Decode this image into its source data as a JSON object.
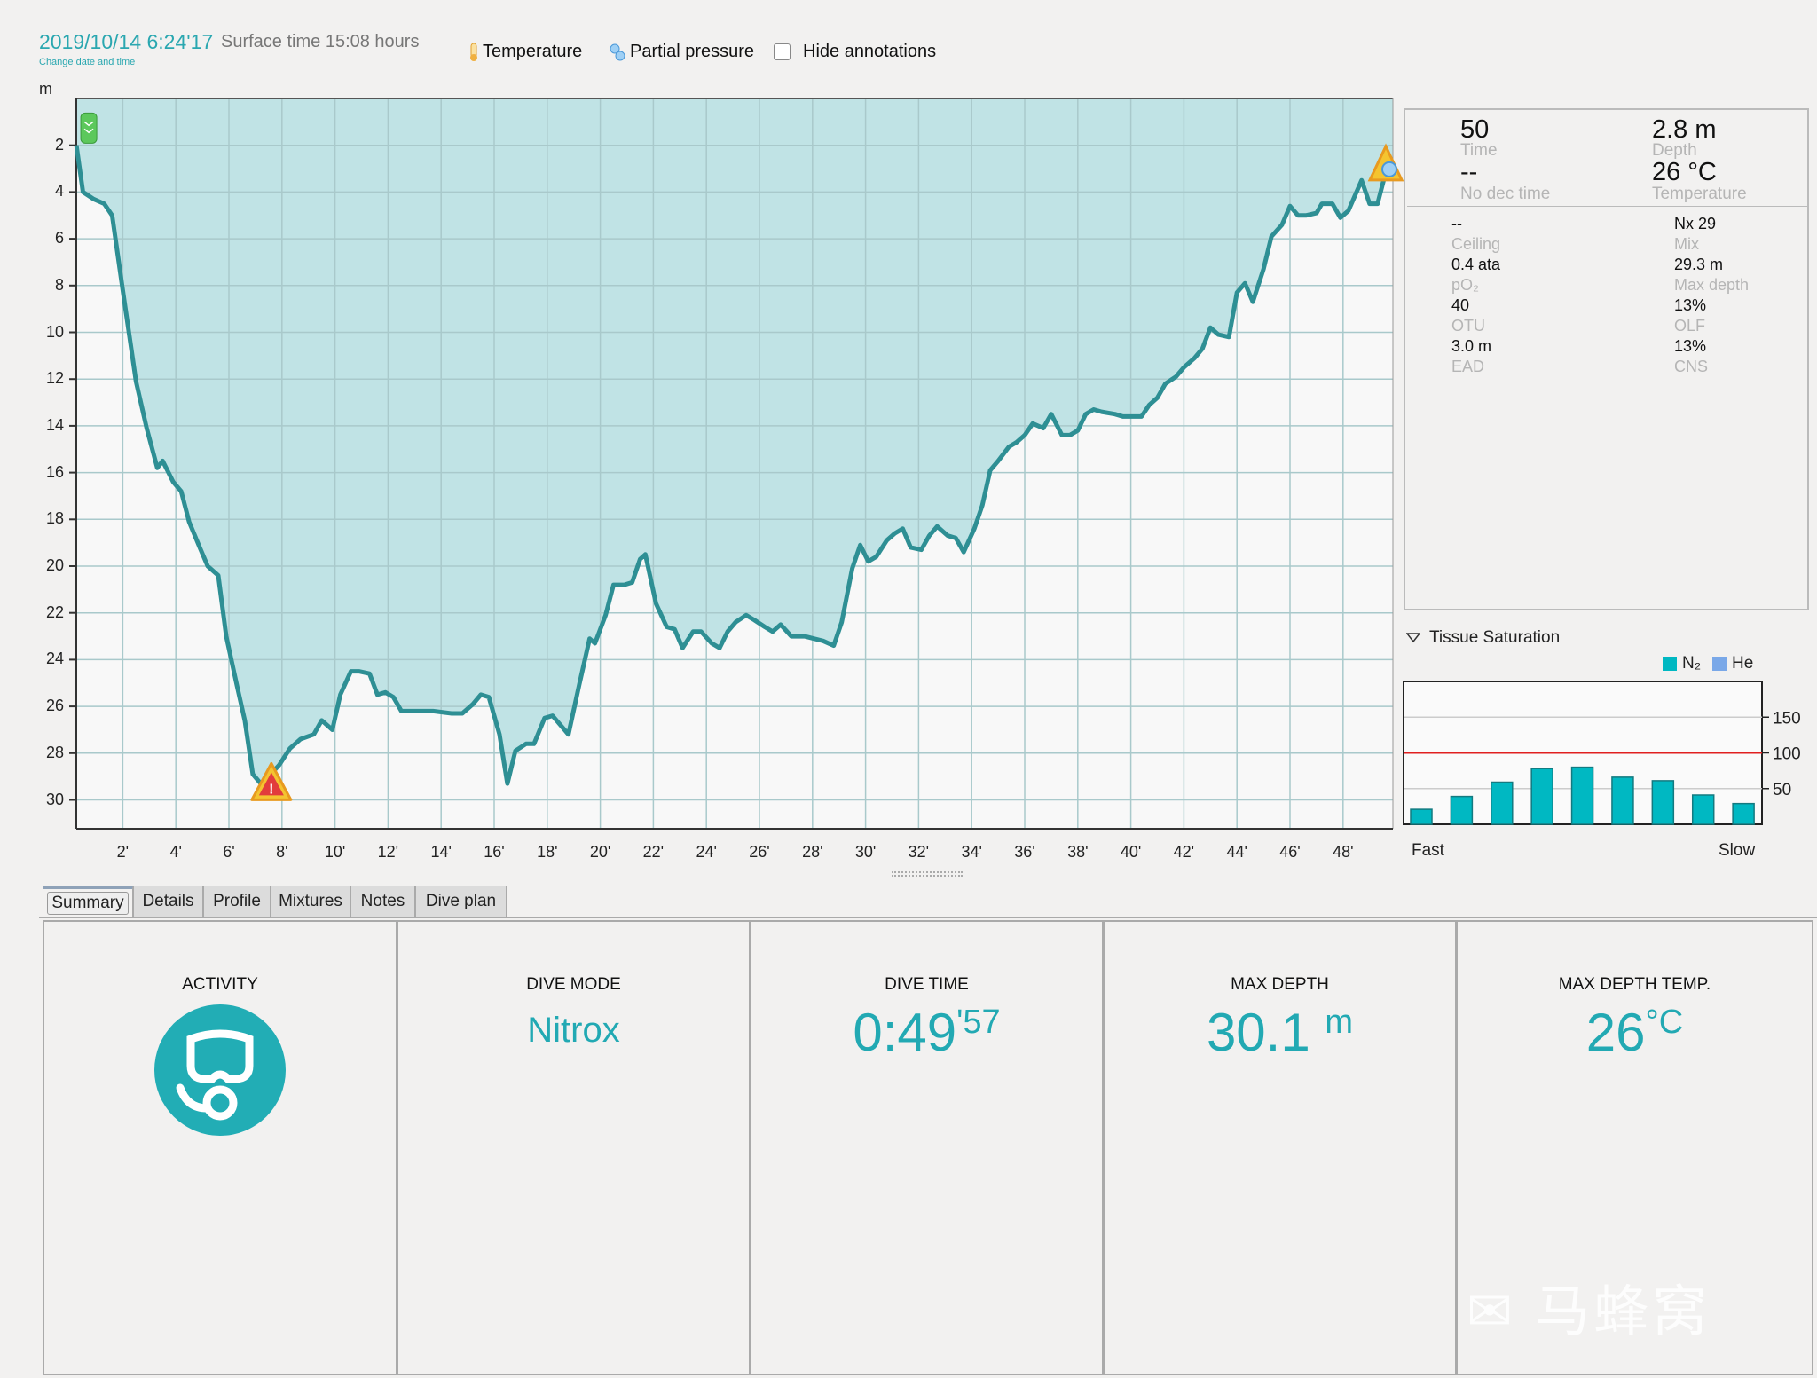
{
  "header": {
    "datetime": "2019/10/14 6:24'17",
    "surface_time": "Surface time 15:08 hours",
    "change_link": "Change date and time",
    "toggles": [
      {
        "label": "Temperature",
        "icon": "thermometer-icon"
      },
      {
        "label": "Partial pressure",
        "icon": "bubbles-icon"
      },
      {
        "label": "Hide annotations",
        "icon": "checkbox",
        "checked": false
      }
    ]
  },
  "colors": {
    "accent": "#22a9b3",
    "profile_fill": "#c0e3e5",
    "profile_line": "#2e8f94",
    "ceiling_line": "#e02020",
    "n2": "#00b8c2",
    "he": "#7aa8e8"
  },
  "chart_data": [
    {
      "type": "area",
      "ylabel": "m",
      "yreversed": true,
      "xlim": [
        0,
        50
      ],
      "ylim": [
        0,
        31.2
      ],
      "grid": true,
      "yticks": [
        2,
        4,
        6,
        8,
        10,
        12,
        14,
        16,
        18,
        20,
        22,
        24,
        26,
        28,
        30
      ],
      "xticks": [
        "2'",
        "4'",
        "6'",
        "8'",
        "10'",
        "12'",
        "14'",
        "16'",
        "18'",
        "20'",
        "22'",
        "24'",
        "26'",
        "28'",
        "30'",
        "32'",
        "34'",
        "36'",
        "38'",
        "40'",
        "42'",
        "44'",
        "46'",
        "48'"
      ],
      "xtick_values": [
        2,
        4,
        6,
        8,
        10,
        12,
        14,
        16,
        18,
        20,
        22,
        24,
        26,
        28,
        30,
        32,
        34,
        36,
        38,
        40,
        42,
        44,
        46,
        48
      ],
      "annotations": [
        {
          "type": "descent",
          "t": 0.25,
          "depth": 1
        },
        {
          "type": "warning",
          "t": 7.5,
          "depth": 29.5
        },
        {
          "type": "end",
          "t": 49.8,
          "depth": 2.5
        }
      ],
      "points": [
        [
          0.25,
          2
        ],
        [
          0.5,
          4
        ],
        [
          0.9,
          4.3
        ],
        [
          1.3,
          4.5
        ],
        [
          1.6,
          5.0
        ],
        [
          2.0,
          8.2
        ],
        [
          2.5,
          12.1
        ],
        [
          2.9,
          14.1
        ],
        [
          3.3,
          15.8
        ],
        [
          3.5,
          15.5
        ],
        [
          3.9,
          16.4
        ],
        [
          4.2,
          16.8
        ],
        [
          4.5,
          18.1
        ],
        [
          4.9,
          19.2
        ],
        [
          5.2,
          20.0
        ],
        [
          5.6,
          20.4
        ],
        [
          5.9,
          23.0
        ],
        [
          6.3,
          25.1
        ],
        [
          6.6,
          26.6
        ],
        [
          6.9,
          28.9
        ],
        [
          7.2,
          29.3
        ],
        [
          7.5,
          29.0
        ],
        [
          7.9,
          28.5
        ],
        [
          8.3,
          27.8
        ],
        [
          8.7,
          27.4
        ],
        [
          9.2,
          27.2
        ],
        [
          9.5,
          26.6
        ],
        [
          9.9,
          27.0
        ],
        [
          10.2,
          25.5
        ],
        [
          10.6,
          24.5
        ],
        [
          10.9,
          24.5
        ],
        [
          11.3,
          24.6
        ],
        [
          11.6,
          25.5
        ],
        [
          11.9,
          25.4
        ],
        [
          12.2,
          25.6
        ],
        [
          12.5,
          26.2
        ],
        [
          13.1,
          26.2
        ],
        [
          13.7,
          26.2
        ],
        [
          14.4,
          26.3
        ],
        [
          14.8,
          26.3
        ],
        [
          15.2,
          25.9
        ],
        [
          15.5,
          25.5
        ],
        [
          15.8,
          25.6
        ],
        [
          16.2,
          27.2
        ],
        [
          16.5,
          29.3
        ],
        [
          16.8,
          27.9
        ],
        [
          17.2,
          27.6
        ],
        [
          17.5,
          27.6
        ],
        [
          17.9,
          26.5
        ],
        [
          18.2,
          26.4
        ],
        [
          18.5,
          26.8
        ],
        [
          18.8,
          27.2
        ],
        [
          19.2,
          25.1
        ],
        [
          19.6,
          23.1
        ],
        [
          19.8,
          23.3
        ],
        [
          20.2,
          22.1
        ],
        [
          20.5,
          20.8
        ],
        [
          20.9,
          20.8
        ],
        [
          21.2,
          20.7
        ],
        [
          21.5,
          19.7
        ],
        [
          21.7,
          19.5
        ],
        [
          22.1,
          21.6
        ],
        [
          22.5,
          22.6
        ],
        [
          22.8,
          22.7
        ],
        [
          23.1,
          23.5
        ],
        [
          23.5,
          22.8
        ],
        [
          23.8,
          22.8
        ],
        [
          24.2,
          23.3
        ],
        [
          24.5,
          23.5
        ],
        [
          24.8,
          22.8
        ],
        [
          25.1,
          22.4
        ],
        [
          25.5,
          22.1
        ],
        [
          25.8,
          22.3
        ],
        [
          26.2,
          22.6
        ],
        [
          26.5,
          22.8
        ],
        [
          26.8,
          22.5
        ],
        [
          27.2,
          23.0
        ],
        [
          27.7,
          23.0
        ],
        [
          28.4,
          23.2
        ],
        [
          28.8,
          23.4
        ],
        [
          29.1,
          22.4
        ],
        [
          29.5,
          20.1
        ],
        [
          29.8,
          19.1
        ],
        [
          30.1,
          19.8
        ],
        [
          30.4,
          19.6
        ],
        [
          30.8,
          18.9
        ],
        [
          31.1,
          18.6
        ],
        [
          31.4,
          18.4
        ],
        [
          31.7,
          19.2
        ],
        [
          32.1,
          19.3
        ],
        [
          32.4,
          18.7
        ],
        [
          32.7,
          18.3
        ],
        [
          33.1,
          18.7
        ],
        [
          33.4,
          18.8
        ],
        [
          33.7,
          19.4
        ],
        [
          34.1,
          18.4
        ],
        [
          34.4,
          17.4
        ],
        [
          34.7,
          15.9
        ],
        [
          35.0,
          15.5
        ],
        [
          35.4,
          14.9
        ],
        [
          35.7,
          14.7
        ],
        [
          36.0,
          14.4
        ],
        [
          36.3,
          13.9
        ],
        [
          36.7,
          14.1
        ],
        [
          37.0,
          13.5
        ],
        [
          37.4,
          14.4
        ],
        [
          37.7,
          14.4
        ],
        [
          38.0,
          14.2
        ],
        [
          38.3,
          13.5
        ],
        [
          38.6,
          13.3
        ],
        [
          38.9,
          13.4
        ],
        [
          39.4,
          13.5
        ],
        [
          39.7,
          13.6
        ],
        [
          40.4,
          13.6
        ],
        [
          40.7,
          13.1
        ],
        [
          41.0,
          12.8
        ],
        [
          41.3,
          12.2
        ],
        [
          41.7,
          11.9
        ],
        [
          42.0,
          11.5
        ],
        [
          42.4,
          11.1
        ],
        [
          42.7,
          10.7
        ],
        [
          43.0,
          9.8
        ],
        [
          43.3,
          10.1
        ],
        [
          43.7,
          10.2
        ],
        [
          44.0,
          8.3
        ],
        [
          44.3,
          7.9
        ],
        [
          44.6,
          8.7
        ],
        [
          45.0,
          7.3
        ],
        [
          45.3,
          5.9
        ],
        [
          45.7,
          5.4
        ],
        [
          46.0,
          4.6
        ],
        [
          46.3,
          5.0
        ],
        [
          46.6,
          5.0
        ],
        [
          47.0,
          4.9
        ],
        [
          47.2,
          4.5
        ],
        [
          47.6,
          4.5
        ],
        [
          47.9,
          5.1
        ],
        [
          48.2,
          4.8
        ],
        [
          48.7,
          3.5
        ],
        [
          49.0,
          4.5
        ],
        [
          49.3,
          4.5
        ],
        [
          49.6,
          3.2
        ],
        [
          49.8,
          2.7
        ]
      ]
    },
    {
      "type": "bar",
      "title": "Tissue Saturation",
      "legend": [
        {
          "name": "N₂",
          "color": "#00b8c2"
        },
        {
          "name": "He",
          "color": "#7aa8e8"
        }
      ],
      "legend_placement": "top-right",
      "ylim": [
        0,
        200
      ],
      "yticks": [
        50,
        100,
        150
      ],
      "reference_line": 100,
      "x_start_label": "Fast",
      "x_end_label": "Slow",
      "values": [
        21,
        39,
        59,
        78,
        80,
        66,
        61,
        41,
        29
      ]
    }
  ],
  "info_panel": {
    "top": [
      {
        "value": "50",
        "label": "Time"
      },
      {
        "value": "2.8 m",
        "label": "Depth"
      },
      {
        "value": "--",
        "label": "No dec time"
      },
      {
        "value": "26 °C",
        "label": "Temperature"
      }
    ],
    "left": [
      {
        "value": "--",
        "label": "Ceiling"
      },
      {
        "value": "0.4 ata",
        "label": "pO₂"
      },
      {
        "value": "40",
        "label": "OTU"
      },
      {
        "value": "3.0 m",
        "label": "EAD"
      }
    ],
    "right": [
      {
        "value": "Nx 29",
        "label": "Mix"
      },
      {
        "value": "29.3 m",
        "label": "Max depth"
      },
      {
        "value": "13%",
        "label": "OLF"
      },
      {
        "value": "13%",
        "label": "CNS"
      }
    ]
  },
  "tabs": [
    "Summary",
    "Details",
    "Profile",
    "Mixtures",
    "Notes",
    "Dive plan"
  ],
  "summary": {
    "activity": {
      "title": "ACTIVITY",
      "icon": "scuba-mask-icon"
    },
    "dive_mode": {
      "title": "DIVE MODE",
      "value": "Nitrox"
    },
    "dive_time": {
      "title": "DIVE TIME",
      "value": "0:49",
      "seconds": "57"
    },
    "max_depth": {
      "title": "MAX DEPTH",
      "value": "30.1",
      "unit": "m"
    },
    "max_depth_temp": {
      "title": "MAX DEPTH TEMP.",
      "value": "26",
      "unit": "°C"
    }
  },
  "watermark": "马蜂窝"
}
